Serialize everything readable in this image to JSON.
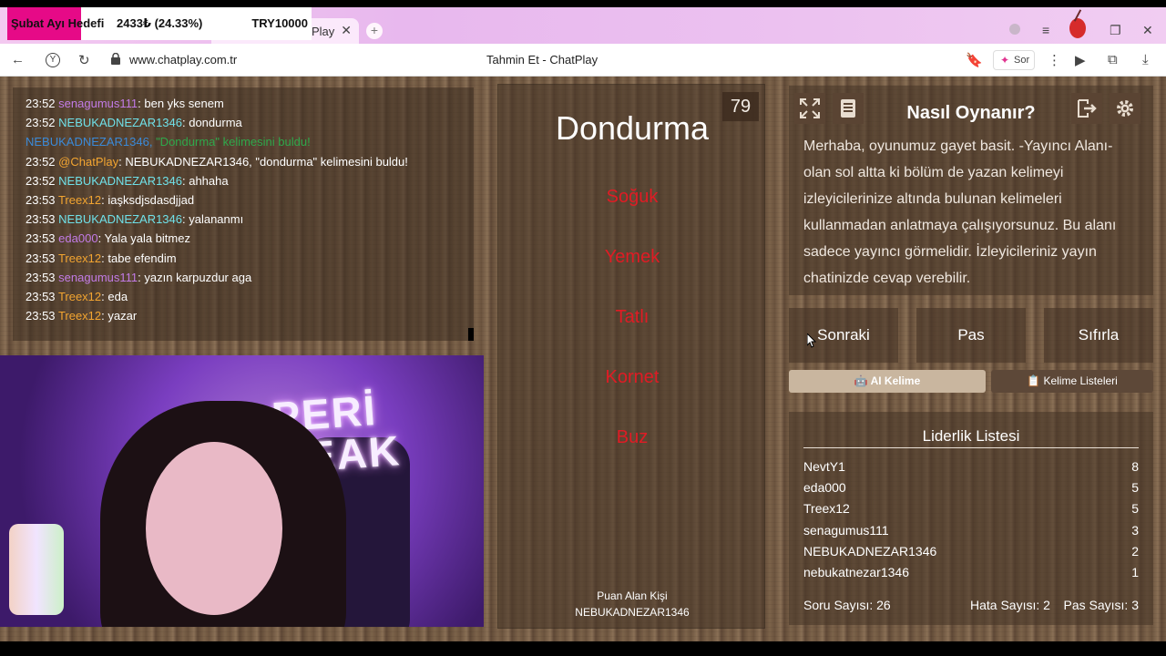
{
  "overlay": {
    "goal_label": "Şubat Ayı Hedefi",
    "goal_amount": "2433₺ (24.33%)",
    "goal_target": "TRY10000"
  },
  "browser": {
    "tab_title": "Play",
    "url": "www.chatplay.com.tr",
    "page_title": "Tahmin Et - ChatPlay",
    "ask_button": "Sor"
  },
  "chat": {
    "lines": [
      {
        "time": "23:52",
        "user": "senagumus111",
        "user_color": "#c27be6",
        "msg": ": ben yks senem"
      },
      {
        "time": "23:52",
        "user": "NEBUKADNEZAR1346",
        "user_color": "#6fe0e8",
        "msg": ": dondurma"
      },
      {
        "time": "",
        "user": "NEBUKADNEZAR1346, ",
        "user_color": "#3b8ad8",
        "msg": "\"Dondurma\" kelimesini buldu!"
      },
      {
        "time": "23:52",
        "user": "@ChatPlay",
        "user_color": "#f3a531",
        "msg": ": NEBUKADNEZAR1346, \"dondurma\" kelimesini buldu!"
      },
      {
        "time": "23:52",
        "user": "NEBUKADNEZAR1346",
        "user_color": "#6fe0e8",
        "msg": ": ahhaha"
      },
      {
        "time": "23:53",
        "user": "Treex12",
        "user_color": "#f3a531",
        "msg": ": iaşksdjsdasdjjad"
      },
      {
        "time": "23:53",
        "user": "NEBUKADNEZAR1346",
        "user_color": "#6fe0e8",
        "msg": ": yalananmı"
      },
      {
        "time": "23:53",
        "user": "eda000",
        "user_color": "#c27be6",
        "msg": ": Yala yala bitmez"
      },
      {
        "time": "23:53",
        "user": "Treex12",
        "user_color": "#f3a531",
        "msg": ": tabe efendim"
      },
      {
        "time": "23:53",
        "user": "senagumus111",
        "user_color": "#c27be6",
        "msg": ": yazın karpuzdur aga"
      },
      {
        "time": "23:53",
        "user": "Treex12",
        "user_color": "#f3a531",
        "msg": ": eda"
      },
      {
        "time": "23:53",
        "user": "Treex12",
        "user_color": "#f3a531",
        "msg": ": yazar"
      }
    ]
  },
  "webcam": {
    "sign_line1": "PERİ",
    "sign_line2": "REAK"
  },
  "game": {
    "timer": "79",
    "word": "Dondurma",
    "taboo": [
      "Soğuk",
      "Yemek",
      "Tatlı",
      "Kornet",
      "Buz"
    ],
    "scorer_label": "Puan Alan Kişi",
    "scorer_name": "NEBUKADNEZAR1346"
  },
  "howto": {
    "title": "Nasıl Oynanır?",
    "text": "Merhaba, oyunumuz gayet basit. -Yayıncı Alanı- olan sol altta ki bölüm de yazan kelimeyi izleyicilerinize altında bulunan kelimeleri kullanmadan anlatmaya çalışıyorsunuz. Bu alanı sadece yayıncı görmelidir. İzleyicileriniz yayın chatinizde cevap verebilir."
  },
  "actions": {
    "next": "Sonraki",
    "pass": "Pas",
    "reset": "Sıfırla",
    "ai_word": "AI Kelime",
    "word_lists": "Kelime Listeleri"
  },
  "leaderboard": {
    "title": "Liderlik Listesi",
    "rows": [
      {
        "name": "NevtY1",
        "score": "8"
      },
      {
        "name": "eda000",
        "score": "5"
      },
      {
        "name": "Treex12",
        "score": "5"
      },
      {
        "name": "senagumus111",
        "score": "3"
      },
      {
        "name": "NEBUKADNEZAR1346",
        "score": "2"
      },
      {
        "name": "nebukatnezar1346",
        "score": "1"
      }
    ],
    "questions": "Soru Sayısı: 26",
    "errors": "Hata Sayısı: 2",
    "passes": "Pas Sayısı: 3"
  }
}
